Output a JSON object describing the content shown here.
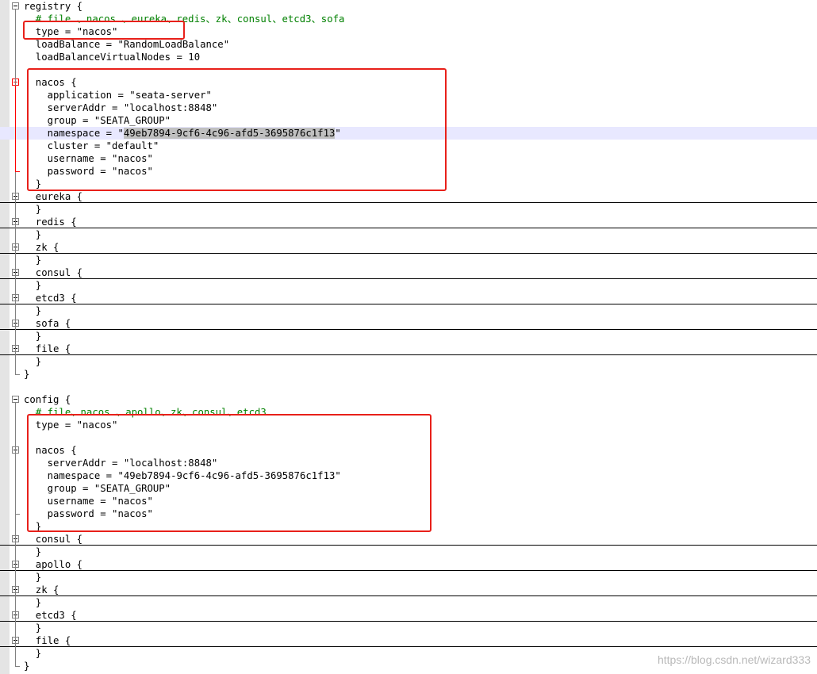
{
  "editor": {
    "file_lines": [
      {
        "text": "registry {",
        "fold": "open"
      },
      {
        "text": "  # file 、nacos 、eureka、redis、zk、consul、etcd3、sofa",
        "kind": "comment"
      },
      {
        "text": "  type = \"nacos\""
      },
      {
        "text": "  loadBalance = \"RandomLoadBalance\""
      },
      {
        "text": "  loadBalanceVirtualNodes = 10"
      },
      {
        "text": ""
      },
      {
        "text": "  nacos {",
        "fold": "open",
        "red": true
      },
      {
        "text": "    application = \"seata-server\""
      },
      {
        "text": "    serverAddr = \"localhost:8848\""
      },
      {
        "text": "    group = \"SEATA_GROUP\""
      },
      {
        "text": "    namespace = \"",
        "selected": "49eb7894-9cf6-4c96-afd5-3695876c1f13",
        "after": "\"",
        "highlight": true
      },
      {
        "text": "    cluster = \"default\""
      },
      {
        "text": "    username = \"nacos\""
      },
      {
        "text": "    password = \"nacos\""
      },
      {
        "text": "  }"
      },
      {
        "text": "  eureka {",
        "fold": "closed",
        "sep": true
      },
      {
        "text": "  }"
      },
      {
        "text": "  redis {",
        "fold": "closed",
        "sep": true
      },
      {
        "text": "  }"
      },
      {
        "text": "  zk {",
        "fold": "closed",
        "sep": true
      },
      {
        "text": "  }"
      },
      {
        "text": "  consul {",
        "fold": "closed",
        "sep": true
      },
      {
        "text": "  }"
      },
      {
        "text": "  etcd3 {",
        "fold": "closed",
        "sep": true
      },
      {
        "text": "  }"
      },
      {
        "text": "  sofa {",
        "fold": "closed",
        "sep": true
      },
      {
        "text": "  }"
      },
      {
        "text": "  file {",
        "fold": "closed",
        "sep": true
      },
      {
        "text": "  }"
      },
      {
        "text": "}"
      },
      {
        "text": ""
      },
      {
        "text": "config {",
        "fold": "open"
      },
      {
        "text": "  # file、nacos 、apollo、zk、consul、etcd3",
        "kind": "comment"
      },
      {
        "text": "  type = \"nacos\""
      },
      {
        "text": ""
      },
      {
        "text": "  nacos {",
        "fold": "open"
      },
      {
        "text": "    serverAddr = \"localhost:8848\""
      },
      {
        "text": "    namespace = \"49eb7894-9cf6-4c96-afd5-3695876c1f13\""
      },
      {
        "text": "    group = \"SEATA_GROUP\""
      },
      {
        "text": "    username = \"nacos\""
      },
      {
        "text": "    password = \"nacos\""
      },
      {
        "text": "  }"
      },
      {
        "text": "  consul {",
        "fold": "closed",
        "sep": true
      },
      {
        "text": "  }"
      },
      {
        "text": "  apollo {",
        "fold": "closed",
        "sep": true
      },
      {
        "text": "  }"
      },
      {
        "text": "  zk {",
        "fold": "closed",
        "sep": true
      },
      {
        "text": "  }"
      },
      {
        "text": "  etcd3 {",
        "fold": "closed",
        "sep": true
      },
      {
        "text": "  }"
      },
      {
        "text": "  file {",
        "fold": "closed",
        "sep": true
      },
      {
        "text": "  }"
      },
      {
        "text": "}"
      }
    ]
  },
  "watermark": "https://blog.csdn.net/wizard333",
  "colors": {
    "comment": "#008000",
    "callout": "#e8201a",
    "highlight": "#e8e8ff",
    "selection": "#c0c0c0"
  }
}
